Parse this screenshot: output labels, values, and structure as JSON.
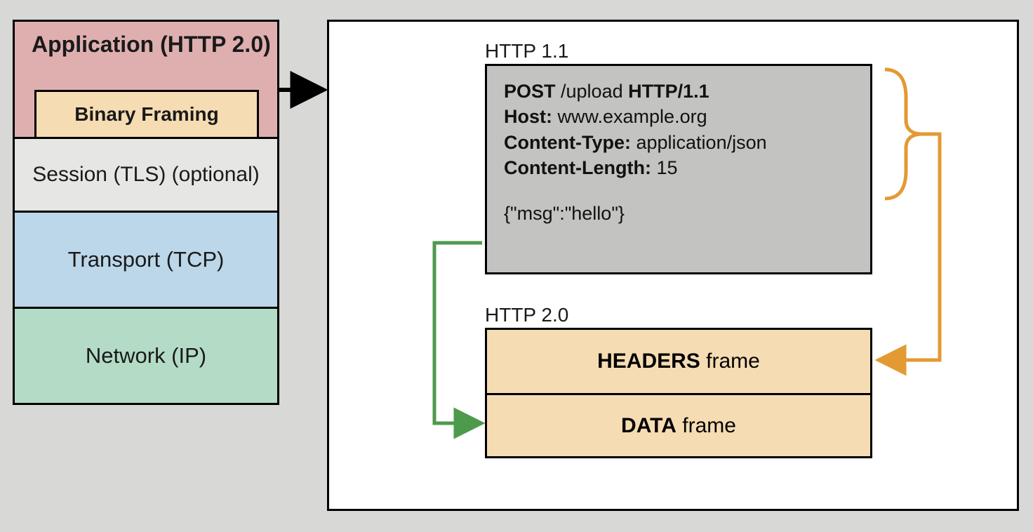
{
  "stack": {
    "application": "Application (HTTP 2.0)",
    "binary_framing": "Binary Framing",
    "session": "Session (TLS) (optional)",
    "transport": "Transport (TCP)",
    "network": "Network (IP)"
  },
  "http11": {
    "label": "HTTP 1.1",
    "request_line_method": "POST",
    "request_line_path": " /upload ",
    "request_line_version": "HTTP/1.1",
    "host_key": "Host:",
    "host_val": " www.example.org",
    "ctype_key": "Content-Type:",
    "ctype_val": " application/json",
    "clen_key": "Content-Length:",
    "clen_val": " 15",
    "body": "{\"msg\":\"hello\"}"
  },
  "http20": {
    "label": "HTTP 2.0",
    "headers_frame_bold": "HEADERS",
    "headers_frame_rest": " frame",
    "data_frame_bold": "DATA",
    "data_frame_rest": " frame"
  }
}
